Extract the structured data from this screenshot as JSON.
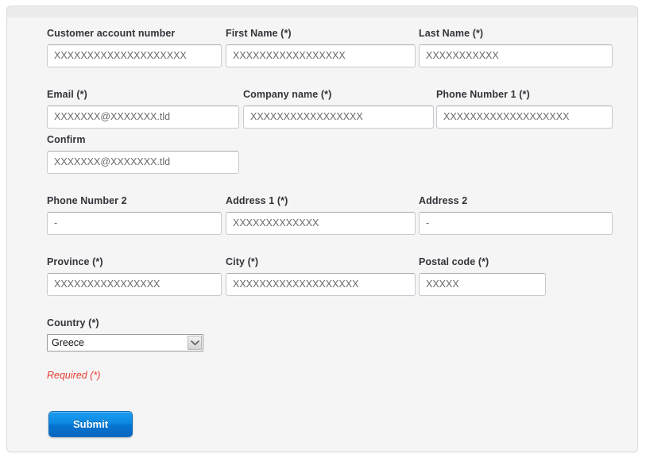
{
  "form": {
    "required_note": "Required (*)",
    "submit_label": "Submit",
    "rows": [
      {
        "fields": [
          {
            "label": "Customer account number",
            "placeholder": "XXXXXXXXXXXXXXXXXXXX",
            "value": ""
          },
          {
            "label": "First Name (*)",
            "placeholder": "XXXXXXXXXXXXXXXXX",
            "value": ""
          },
          {
            "label": "Last Name (*)",
            "placeholder": "XXXXXXXXXXX",
            "value": ""
          }
        ]
      },
      {
        "fields": [
          {
            "label": "Email (*)",
            "placeholder": "XXXXXXX@XXXXXXX.tld",
            "value": ""
          },
          {
            "label": "Company name (*)",
            "placeholder": "XXXXXXXXXXXXXXXXX",
            "value": ""
          },
          {
            "label": "Phone Number 1 (*)",
            "placeholder": "XXXXXXXXXXXXXXXXXXX",
            "value": ""
          }
        ]
      },
      {
        "fields": [
          {
            "label": "Confirm",
            "placeholder": "XXXXXXX@XXXXXXX.tld",
            "value": ""
          }
        ]
      },
      {
        "fields": [
          {
            "label": "Phone Number 2",
            "placeholder": "-",
            "value": ""
          },
          {
            "label": "Address 1 (*)",
            "placeholder": "XXXXXXXXXXXXX",
            "value": ""
          },
          {
            "label": "Address 2",
            "placeholder": "-",
            "value": ""
          }
        ]
      },
      {
        "fields": [
          {
            "label": "Province (*)",
            "placeholder": "XXXXXXXXXXXXXXXX",
            "value": ""
          },
          {
            "label": "City (*)",
            "placeholder": "XXXXXXXXXXXXXXXXXXX",
            "value": ""
          },
          {
            "label": "Postal code (*)",
            "placeholder": "XXXXX",
            "value": ""
          }
        ]
      }
    ],
    "country": {
      "label": "Country (*)",
      "selected": "Greece",
      "icon": "chevron-down-icon"
    }
  },
  "colors": {
    "page_background": "#ffffff",
    "panel_background": "#f5f5f5",
    "panel_border": "#dcdcdc",
    "panel_topstrip": "#ececec",
    "label_text": "#33333a",
    "input_text": "#6a6a6a",
    "input_border": "#c9c9d1",
    "required_red": "#e43b30",
    "submit_blue_top": "#1a9cee",
    "submit_blue_bottom": "#0a66bf",
    "submit_border": "#0f6fbb"
  }
}
